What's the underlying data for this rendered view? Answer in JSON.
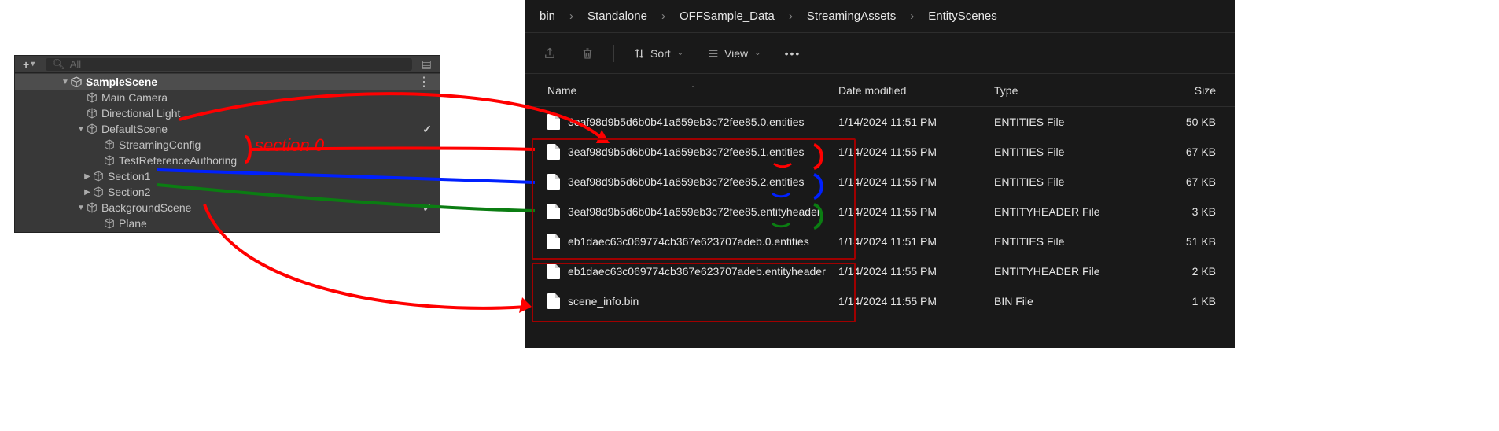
{
  "unity": {
    "search_placeholder": "All",
    "root": "SampleScene",
    "items": [
      {
        "label": "Main Camera"
      },
      {
        "label": "Directional Light"
      },
      {
        "label": "DefaultScene"
      },
      {
        "label": "StreamingConfig"
      },
      {
        "label": "TestReferenceAuthoring"
      },
      {
        "label": "Section1"
      },
      {
        "label": "Section2"
      },
      {
        "label": "BackgroundScene"
      },
      {
        "label": "Plane"
      }
    ]
  },
  "explorer": {
    "breadcrumb": [
      "bin",
      "Standalone",
      "OFFSample_Data",
      "StreamingAssets",
      "EntityScenes"
    ],
    "sort_label": "Sort",
    "view_label": "View",
    "columns": {
      "name": "Name",
      "date": "Date modified",
      "type": "Type",
      "size": "Size"
    },
    "rows": [
      {
        "name": "3eaf98d9b5d6b0b41a659eb3c72fee85.0.entities",
        "date": "1/14/2024 11:51 PM",
        "type": "ENTITIES File",
        "size": "50 KB"
      },
      {
        "name": "3eaf98d9b5d6b0b41a659eb3c72fee85.1.entities",
        "date": "1/14/2024 11:55 PM",
        "type": "ENTITIES File",
        "size": "67 KB"
      },
      {
        "name": "3eaf98d9b5d6b0b41a659eb3c72fee85.2.entities",
        "date": "1/14/2024 11:55 PM",
        "type": "ENTITIES File",
        "size": "67 KB"
      },
      {
        "name": "3eaf98d9b5d6b0b41a659eb3c72fee85.entityheader",
        "date": "1/14/2024 11:55 PM",
        "type": "ENTITYHEADER File",
        "size": "3 KB"
      },
      {
        "name": "eb1daec63c069774cb367e623707adeb.0.entities",
        "date": "1/14/2024 11:51 PM",
        "type": "ENTITIES File",
        "size": "51 KB"
      },
      {
        "name": "eb1daec63c069774cb367e623707adeb.entityheader",
        "date": "1/14/2024 11:55 PM",
        "type": "ENTITYHEADER File",
        "size": "2 KB"
      },
      {
        "name": "scene_info.bin",
        "date": "1/14/2024 11:55 PM",
        "type": "BIN File",
        "size": "1 KB"
      }
    ]
  },
  "annotation": {
    "section_label": "section 0"
  }
}
